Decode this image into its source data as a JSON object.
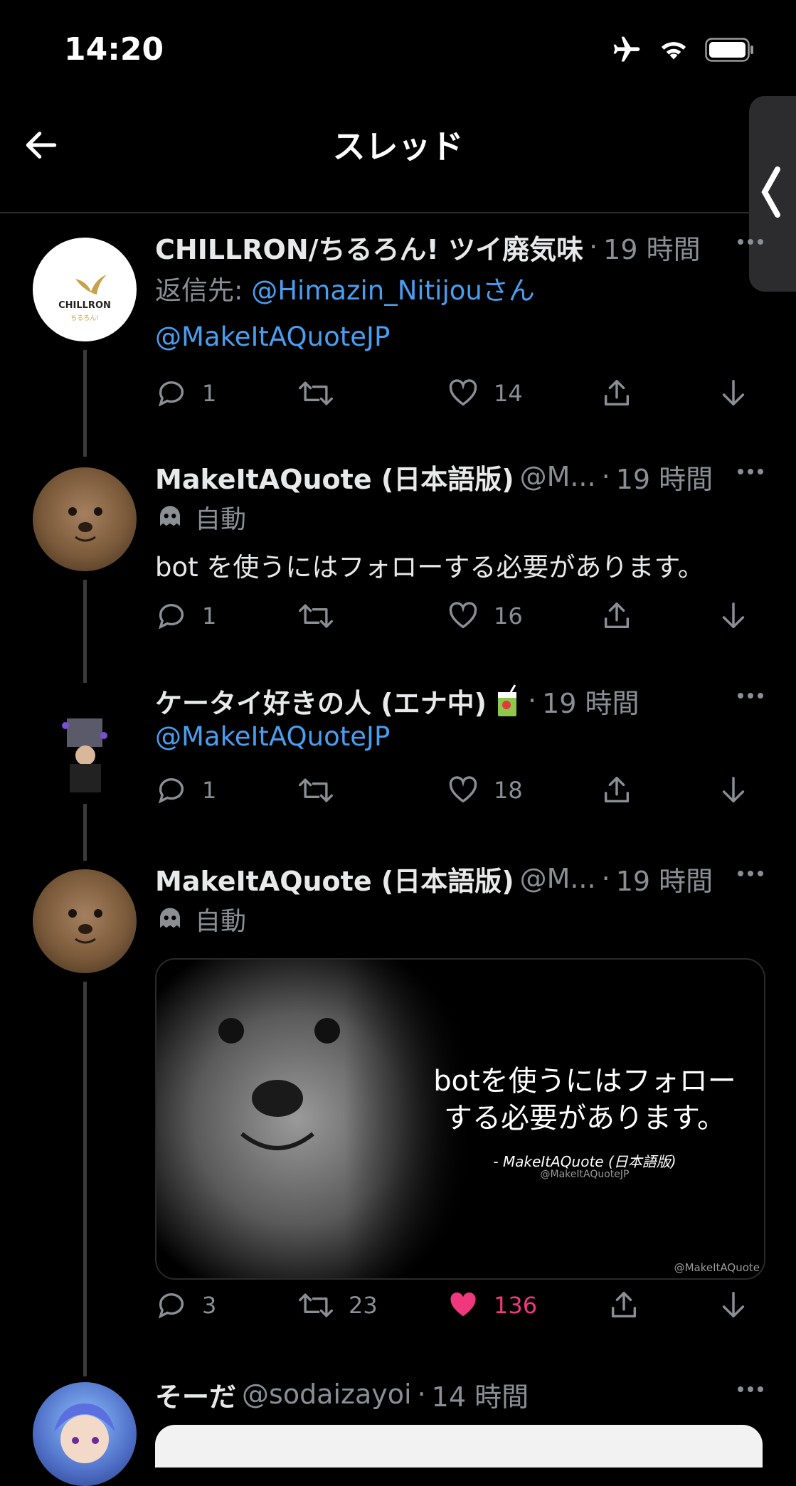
{
  "status": {
    "time": "14:20"
  },
  "header": {
    "title": "スレッド"
  },
  "tweets": [
    {
      "name": "CHILLRON/ちるろん! ツイ廃気味",
      "time": "19 時間",
      "reply_prefix": "返信先: ",
      "reply_to": "@Himazin_Nitijou",
      "reply_suffix": "さん",
      "mention": "@MakeItAQuoteJP",
      "avatar_text": "CHILLRON",
      "avatar_sub": "ちるろん!",
      "replies": "1",
      "retweets": "",
      "likes": "14"
    },
    {
      "name": "MakeItAQuote (日本語版)",
      "handle": "@M...",
      "time": "19 時間",
      "auto": "自動",
      "text": "bot を使うにはフォローする必要があります。",
      "replies": "1",
      "retweets": "",
      "likes": "16"
    },
    {
      "name": "ケータイ好きの人 (エナ中)",
      "time": "19 時間",
      "mention": "@MakeItAQuoteJP",
      "replies": "1",
      "retweets": "",
      "likes": "18"
    },
    {
      "name": "MakeItAQuote (日本語版)",
      "handle": "@M...",
      "time": "19 時間",
      "auto": "自動",
      "quote_text": "botを使うにはフォローする必要があります。",
      "quote_by": "- MakeItAQuote (日本語版)",
      "quote_handle": "@MakeItAQuoteJP",
      "watermark": "@MakeItAQuote",
      "replies": "3",
      "retweets": "23",
      "likes": "136",
      "liked": true
    },
    {
      "name": "そーだ",
      "handle": "@sodaizayoi",
      "time": "14 時間"
    }
  ],
  "colors": {
    "accent": "#4a9ef0",
    "like": "#f0387e",
    "muted": "#8b8f94"
  }
}
